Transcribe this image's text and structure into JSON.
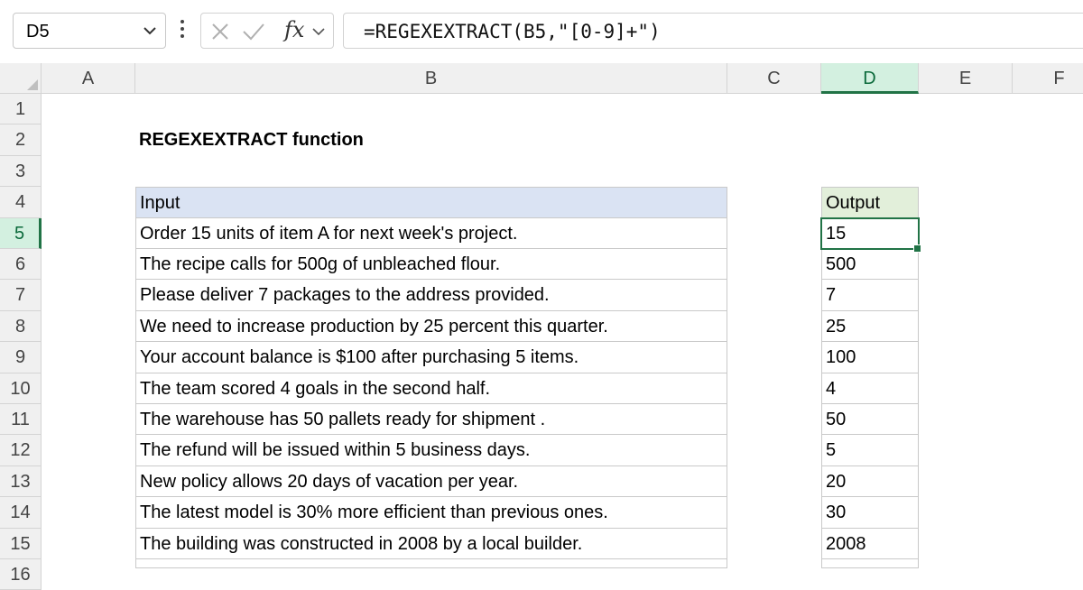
{
  "namebox": {
    "value": "D5"
  },
  "formula_bar": {
    "fx_label": "fx",
    "formula": "=REGEXEXTRACT(B5,\"[0-9]+\")"
  },
  "columns": [
    "A",
    "B",
    "C",
    "D",
    "E",
    "F"
  ],
  "selected_column": "D",
  "rows": [
    "1",
    "2",
    "3",
    "4",
    "5",
    "6",
    "7",
    "8",
    "9",
    "10",
    "11",
    "12",
    "13",
    "14",
    "15",
    "16"
  ],
  "selected_row": "5",
  "title": "REGEXEXTRACT function",
  "table": {
    "input_header": "Input",
    "output_header": "Output",
    "rows": [
      {
        "input": "Order 15 units of item A for next week's project.",
        "output": "15"
      },
      {
        "input": "The recipe calls for 500g of unbleached flour.",
        "output": "500"
      },
      {
        "input": "Please deliver 7 packages to the address provided.",
        "output": "7"
      },
      {
        "input": "We need to increase production by 25 percent this quarter.",
        "output": "25"
      },
      {
        "input": "Your account balance is $100 after purchasing 5 items.",
        "output": "100"
      },
      {
        "input": "The team scored 4 goals in the second half.",
        "output": "4"
      },
      {
        "input": "The warehouse has 50 pallets ready for shipment .",
        "output": "50"
      },
      {
        "input": "The refund will be issued within 5 business days.",
        "output": "5"
      },
      {
        "input": "New policy allows 20 days of vacation per year.",
        "output": "20"
      },
      {
        "input": "The latest model is 30% more efficient than previous ones.",
        "output": "30"
      },
      {
        "input": "The building was constructed in 2008 by a local builder.",
        "output": "2008"
      }
    ]
  },
  "colors": {
    "accent": "#217346",
    "input_header_bg": "#dae3f3",
    "output_header_bg": "#e2efda"
  }
}
